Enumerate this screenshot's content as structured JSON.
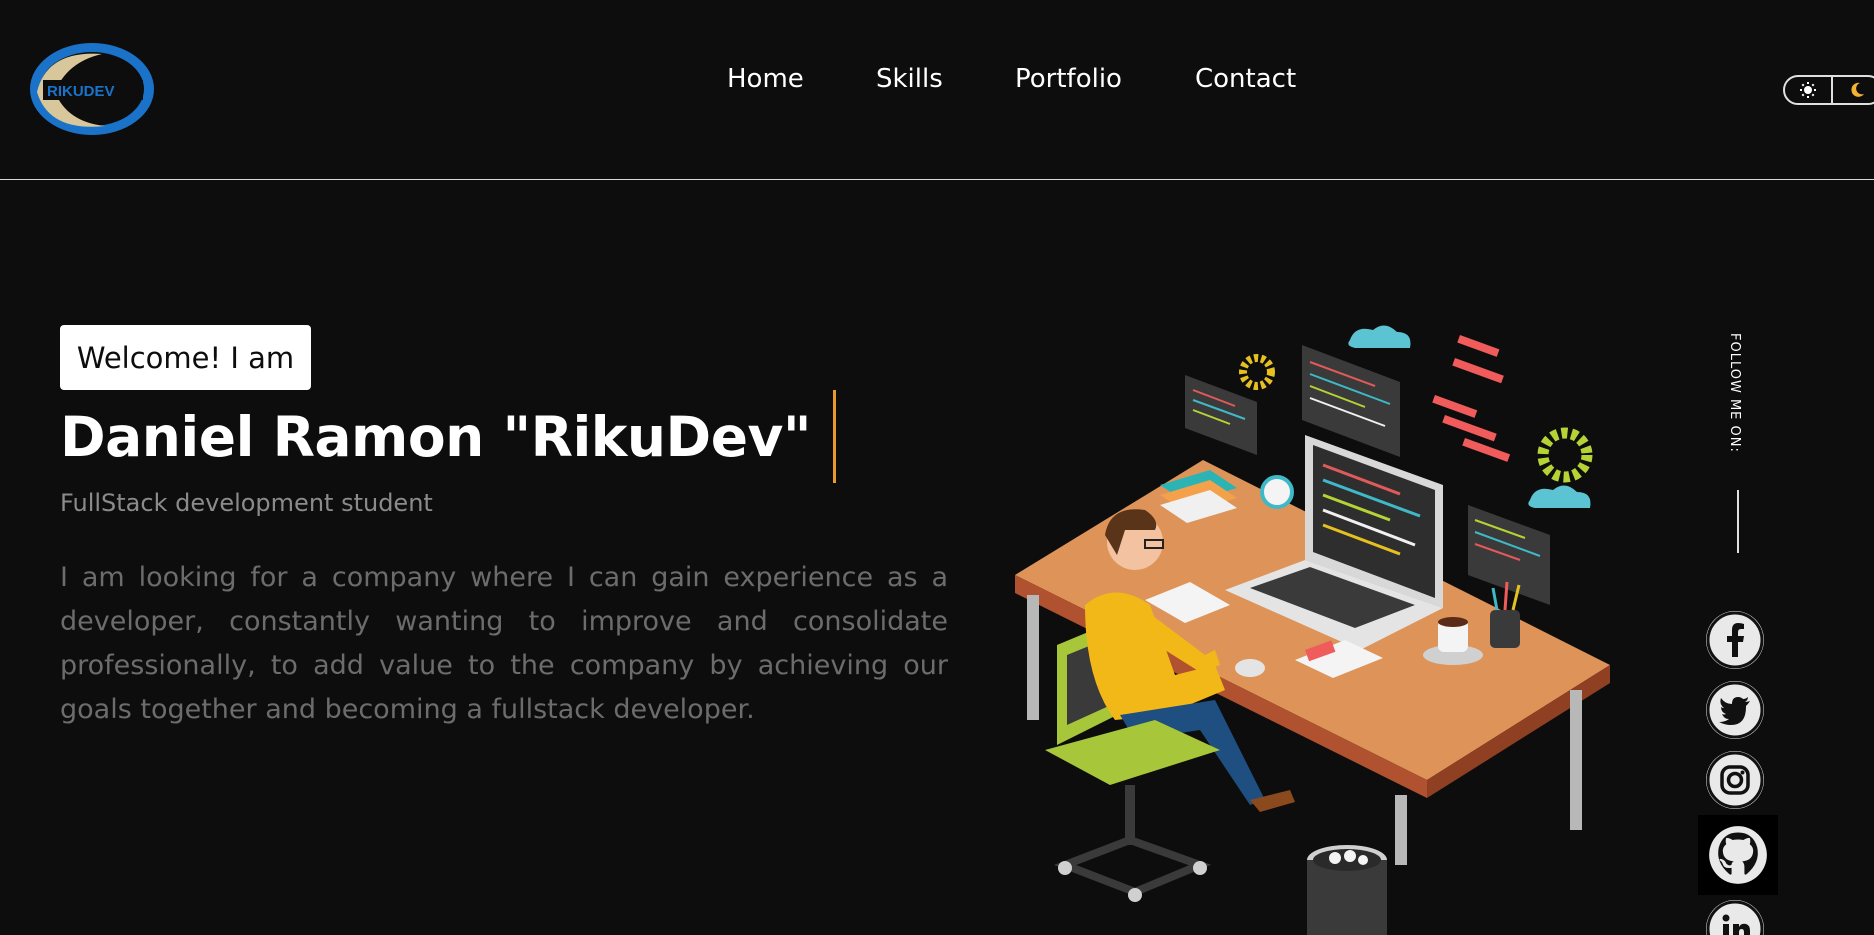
{
  "brand": {
    "logo_text": "RIKUDEV"
  },
  "nav": {
    "items": [
      "Home",
      "Skills",
      "Portfolio",
      "Contact"
    ]
  },
  "theme_toggle": {
    "light_icon": "sun-icon",
    "dark_icon": "moon-icon",
    "moon_color": "#f2b233"
  },
  "hero": {
    "greeting": "Welcome! I am",
    "name": "Daniel Ramon \"RikuDev\"",
    "subtitle": "FullStack development student",
    "description": "I am looking for a company where I can gain experience as a developer, constantly wanting to improve and consolidate professionally, to add value to the company by achieving our goals together and becoming a fullstack developer.",
    "cursor_color": "#e79b2a"
  },
  "illustration": {
    "subject": "developer working at laptop on desk"
  },
  "social": {
    "label": "FOLLOW ME ON:",
    "links": [
      {
        "name": "facebook",
        "icon": "facebook-icon"
      },
      {
        "name": "twitter",
        "icon": "twitter-icon"
      },
      {
        "name": "instagram",
        "icon": "instagram-icon"
      },
      {
        "name": "github",
        "icon": "github-icon"
      },
      {
        "name": "linkedin",
        "icon": "linkedin-icon"
      }
    ]
  },
  "colors": {
    "background": "#0d0d0d",
    "accent": "#e79b2a",
    "logo_blue": "#1a73c9",
    "logo_gold": "#d8c79a"
  }
}
